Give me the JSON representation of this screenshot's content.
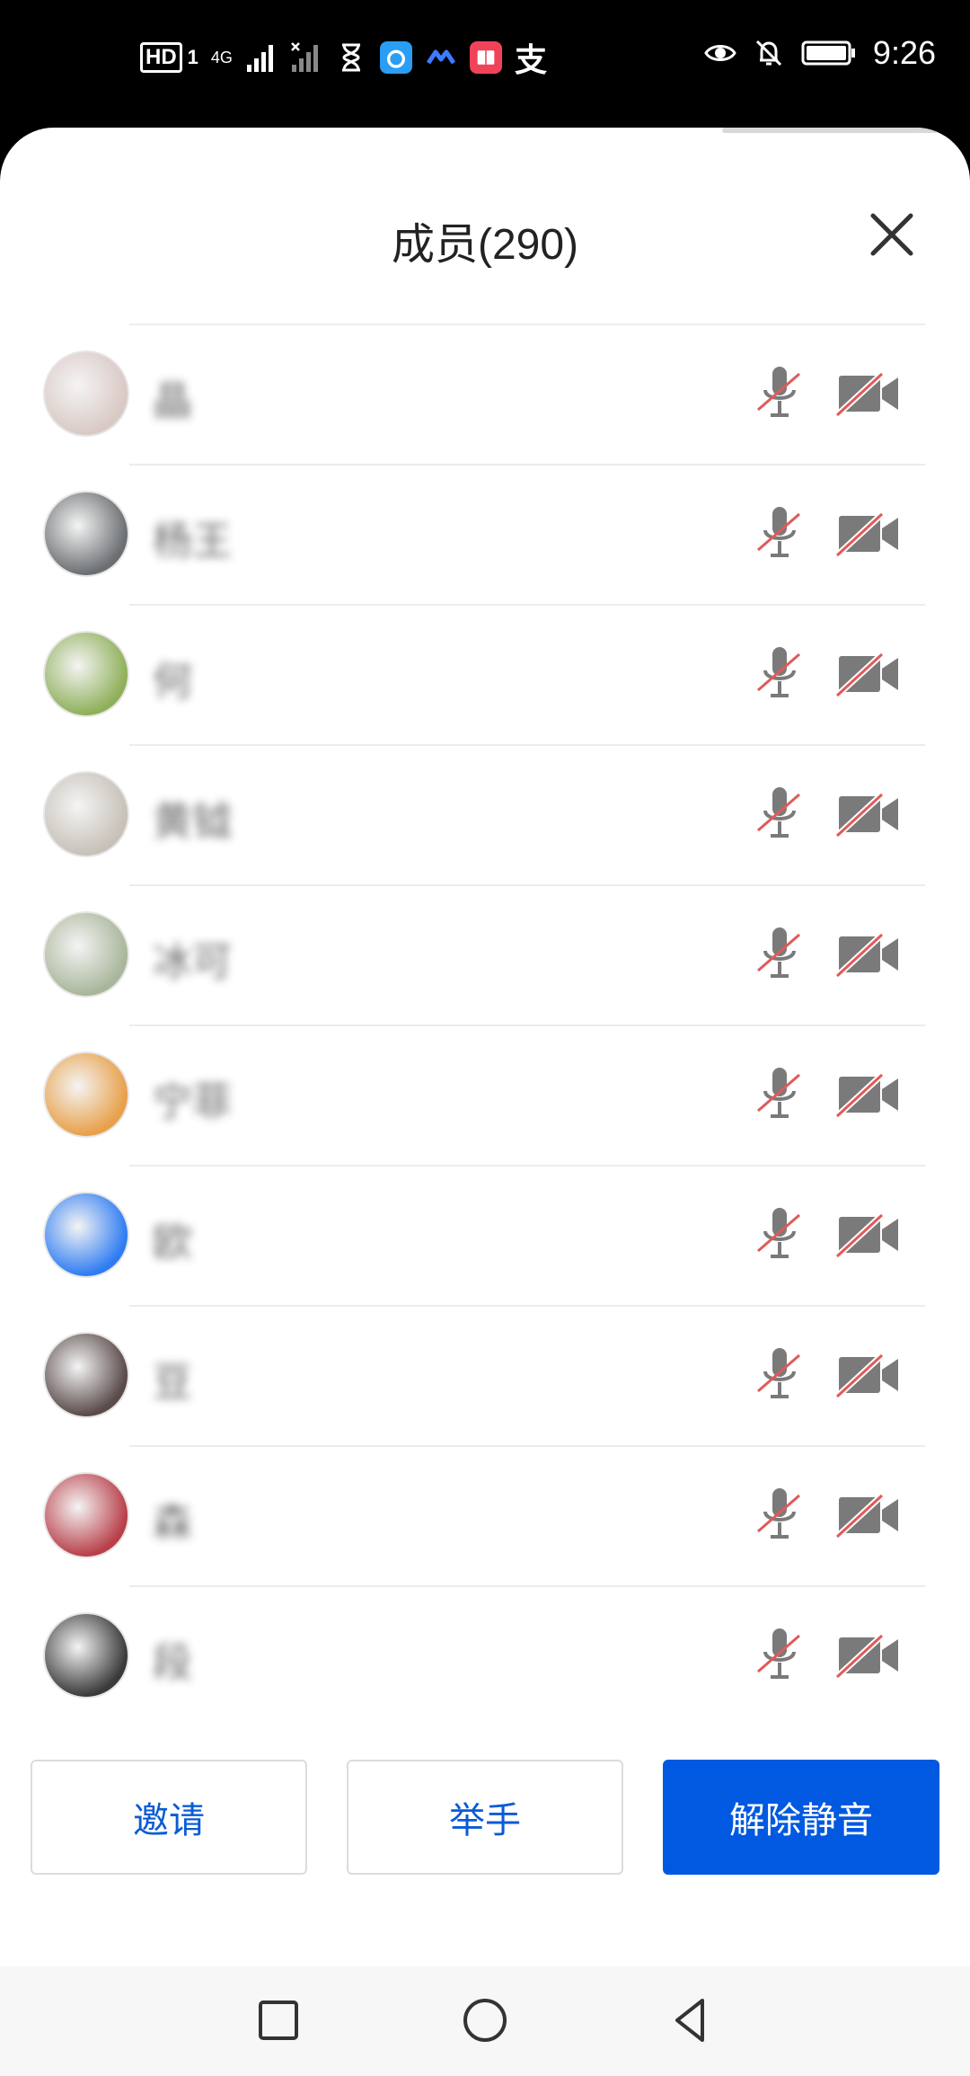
{
  "status_bar": {
    "hd_label": "HD",
    "hd_sub": "1",
    "network_label": "4G",
    "time": "9:26",
    "app_icons": [
      "hourglass-icon",
      "browser-icon",
      "chat-icon",
      "book-icon",
      "alipay-icon"
    ],
    "alipay_glyph": "支"
  },
  "sheet": {
    "title": "成员(290)",
    "close_icon": "close-icon"
  },
  "members": [
    {
      "name": "晶",
      "avatar_color": "#d9c9c4",
      "mic_muted": true,
      "cam_off": true
    },
    {
      "name": "杨王",
      "avatar_color": "#6b6f72",
      "mic_muted": true,
      "cam_off": true
    },
    {
      "name": "何",
      "avatar_color": "#8fb05a",
      "mic_muted": true,
      "cam_off": true
    },
    {
      "name": "黄钺",
      "avatar_color": "#c7c1b8",
      "mic_muted": true,
      "cam_off": true
    },
    {
      "name": "冰可",
      "avatar_color": "#a9b69a",
      "mic_muted": true,
      "cam_off": true
    },
    {
      "name": "宁菲",
      "avatar_color": "#e8a04a",
      "mic_muted": true,
      "cam_off": true
    },
    {
      "name": "欧",
      "avatar_color": "#2f7cf2",
      "mic_muted": true,
      "cam_off": true
    },
    {
      "name": "豆",
      "avatar_color": "#5a4a4a",
      "mic_muted": true,
      "cam_off": true
    },
    {
      "name": "森",
      "avatar_color": "#b8404a",
      "mic_muted": true,
      "cam_off": true
    },
    {
      "name": "段",
      "avatar_color": "#3a3a3a",
      "mic_muted": true,
      "cam_off": true
    }
  ],
  "actions": {
    "invite": "邀请",
    "raise_hand": "举手",
    "unmute": "解除静音"
  },
  "colors": {
    "primary": "#0059e0",
    "link_text": "#0a5bd6",
    "muted_red": "#e05a5a",
    "icon_gray": "#7a7a7a"
  },
  "nav": {
    "icons": [
      "recent-apps-icon",
      "home-icon",
      "back-icon"
    ]
  }
}
